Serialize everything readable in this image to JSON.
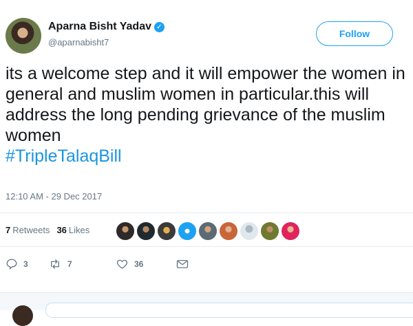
{
  "tweet": {
    "author_name": "Aparna Bisht Yadav",
    "handle": "@aparnabisht7",
    "follow_label": "Follow",
    "text": "its a welcome step and it will empower the women in general and muslim women in particular.this will address the long pending grievance of the muslim women",
    "hashtag": "#TripleTalaqBill",
    "timestamp": "12:10 AM - 29 Dec 2017",
    "retweets_count": "7",
    "retweets_label": "Retweets",
    "likes_count": "36",
    "likes_label": "Likes",
    "reply_count": "3",
    "retweet_action_count": "7",
    "like_action_count": "36"
  },
  "liker_avatars": [
    "avatar-1",
    "avatar-2",
    "avatar-3",
    "avatar-4",
    "avatar-5",
    "avatar-6",
    "avatar-7",
    "avatar-8",
    "avatar-9"
  ],
  "colors": {
    "accent": "#1da1f2",
    "hashtag": "#1b95e0",
    "secondary_text": "#657786",
    "primary_text": "#14171a",
    "divider": "#e6ecf0"
  },
  "icons": {
    "verified": "verified-badge-icon",
    "reply": "reply-icon",
    "retweet": "retweet-icon",
    "like": "heart-icon",
    "message": "direct-message-icon"
  }
}
